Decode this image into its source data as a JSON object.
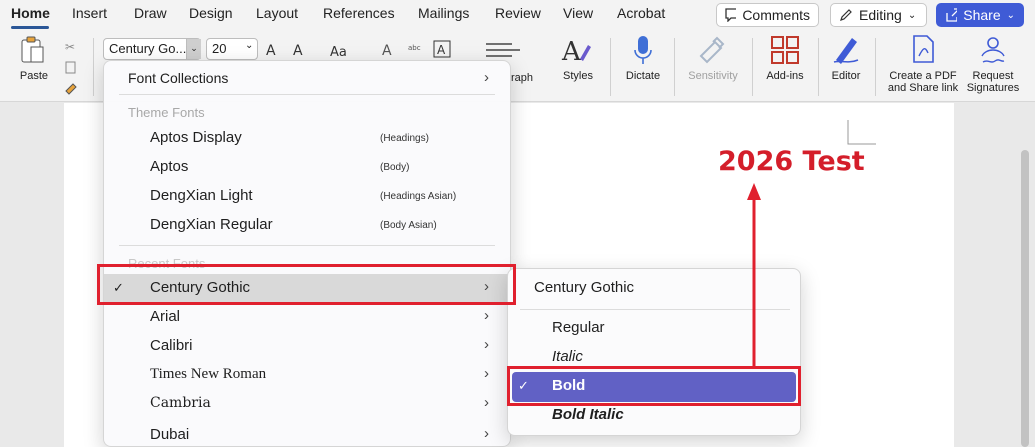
{
  "tabs": [
    "Home",
    "Insert",
    "Draw",
    "Design",
    "Layout",
    "References",
    "Mailings",
    "Review",
    "View",
    "Acrobat"
  ],
  "header": {
    "comments": "Comments",
    "editing": "Editing",
    "share": "Share"
  },
  "ribbon": {
    "paste": "Paste",
    "font_name": "Century Go...",
    "font_size": "20",
    "paragraph_partial": "raph",
    "styles": "Styles",
    "dictate": "Dictate",
    "sensitivity": "Sensitivity",
    "addins": "Add-ins",
    "editor": "Editor",
    "create_pdf_line1": "Create a PDF",
    "create_pdf_line2": "and Share link",
    "request_sig_line1": "Request",
    "request_sig_line2": "Signatures"
  },
  "font_menu": {
    "font_collections": "Font Collections",
    "theme_fonts_header": "Theme Fonts",
    "theme_fonts": [
      {
        "name": "Aptos Display",
        "note": "(Headings)"
      },
      {
        "name": "Aptos",
        "note": "(Body)"
      },
      {
        "name": "DengXian Light",
        "note": "(Headings Asian)"
      },
      {
        "name": "DengXian Regular",
        "note": "(Body Asian)"
      }
    ],
    "recent_fonts_header": "Recent Fonts",
    "recent_fonts": [
      "Century Gothic",
      "Arial",
      "Calibri",
      "Times New Roman",
      "Cambria",
      "Dubai"
    ],
    "check_mark": "✓"
  },
  "submenu": {
    "title": "Century Gothic",
    "styles": [
      "Regular",
      "Italic",
      "Bold",
      "Bold Italic"
    ],
    "check_mark": "✓"
  },
  "annotation": "2026 Test",
  "colors": {
    "accent": "#3f5bd6",
    "highlight": "#e0202e",
    "selected": "#6161c5",
    "annotation": "#d41e2a"
  }
}
